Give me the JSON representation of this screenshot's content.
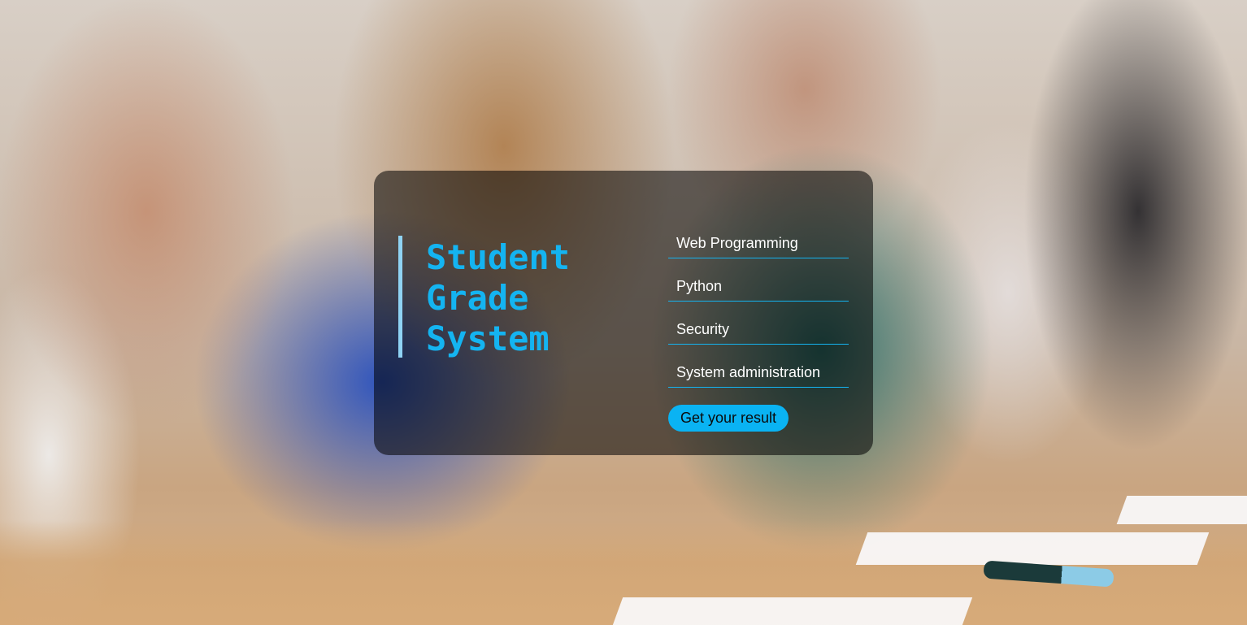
{
  "background": {
    "description_icon": "students-writing-exam-photo"
  },
  "card": {
    "title_lines": [
      "Student",
      "Grade",
      "System"
    ],
    "fields": [
      {
        "placeholder": "Web Programming"
      },
      {
        "placeholder": "Python"
      },
      {
        "placeholder": "Security"
      },
      {
        "placeholder": "System administration"
      }
    ],
    "submit_label": "Get your result"
  },
  "colors": {
    "accent": "#14b4f1",
    "button": "#0ab3f3",
    "accent_bar": "#8fd3f4"
  }
}
